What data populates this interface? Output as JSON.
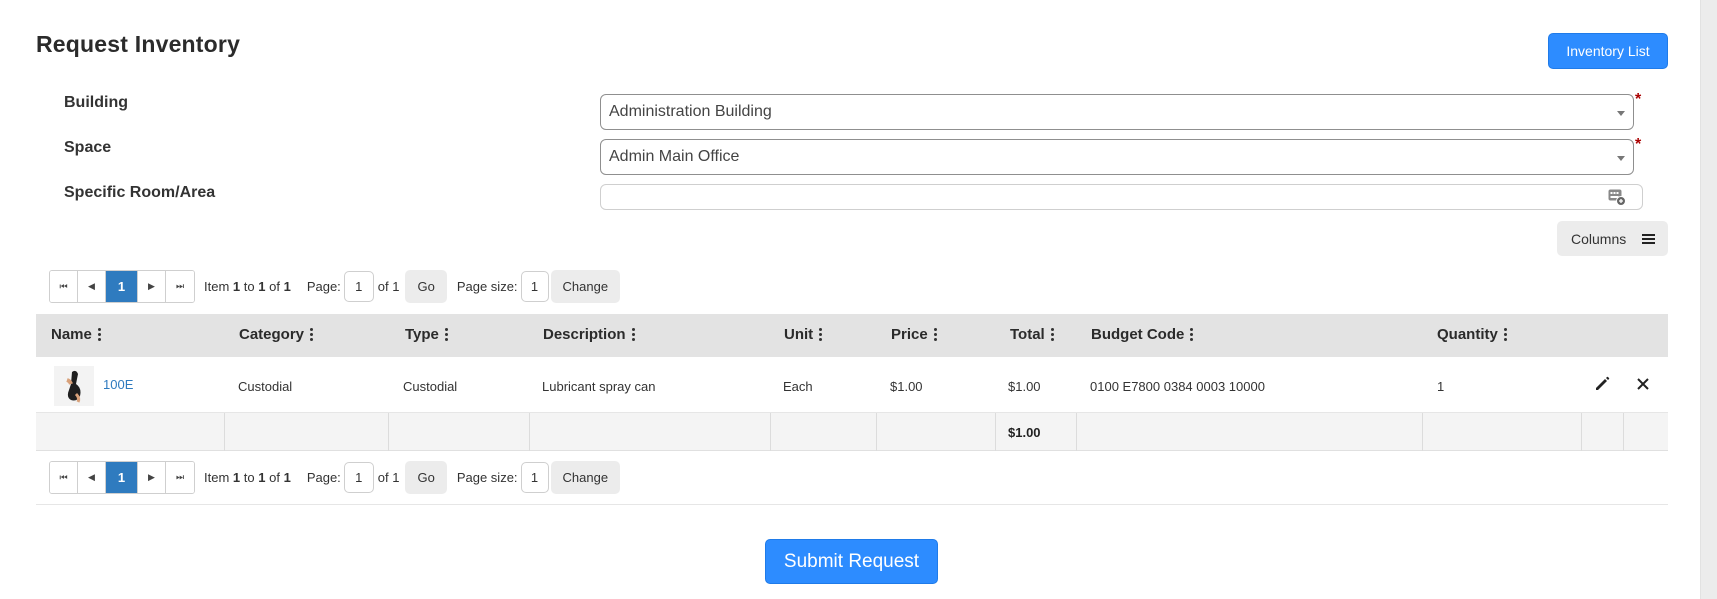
{
  "page": {
    "title": "Request Inventory",
    "inventory_list_button": "Inventory List",
    "submit_button": "Submit Request"
  },
  "form": {
    "building": {
      "label": "Building",
      "value": "Administration Building",
      "required_mark": "*"
    },
    "space": {
      "label": "Space",
      "value": "Admin Main Office",
      "required_mark": "*"
    },
    "room": {
      "label": "Specific Room/Area",
      "value": ""
    }
  },
  "columns_button": "Columns",
  "pager": {
    "current_page": "1",
    "item_prefix": "Item",
    "item_from": "1",
    "item_to_word": "to",
    "item_to": "1",
    "item_of_word": "of",
    "item_total": "1",
    "page_label": "Page:",
    "page_value": "1",
    "of_pages": "of 1",
    "go_button": "Go",
    "page_size_label": "Page size:",
    "page_size_value": "1",
    "change_button": "Change"
  },
  "table": {
    "headers": {
      "name": "Name",
      "category": "Category",
      "type": "Type",
      "description": "Description",
      "unit": "Unit",
      "price": "Price",
      "total": "Total",
      "budget_code": "Budget Code",
      "quantity": "Quantity"
    },
    "rows": [
      {
        "name": "100E",
        "category": "Custodial",
        "type": "Custodial",
        "description": "Lubricant spray can",
        "unit": "Each",
        "price": "$1.00",
        "total": "$1.00",
        "budget_code": "0100 E7800 0384 0003 10000",
        "quantity": "1"
      }
    ],
    "footer_total": "$1.00"
  },
  "icons": {
    "first": "first-page-icon",
    "prev": "prev-page-icon",
    "next": "next-page-icon",
    "last": "last-page-icon",
    "edit": "pencil-icon",
    "delete": "close-icon",
    "columns": "hamburger-icon",
    "input_addon": "keyboard-icon"
  },
  "colors": {
    "primary": "#2d8cff",
    "pager_active": "#2f7bbf",
    "link": "#2f7bbf",
    "required": "#aa0000",
    "header_bg": "#e3e3e3"
  }
}
